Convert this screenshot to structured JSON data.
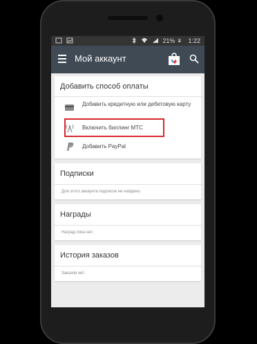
{
  "statusbar": {
    "battery": "21%",
    "time": "1:22"
  },
  "appbar": {
    "title": "Мой аккаунт"
  },
  "payment": {
    "title": "Добавить способ оплаты",
    "items": [
      {
        "label": "Добавить кредитную или дебетовую карту",
        "icon": "credit-card-icon"
      },
      {
        "label": "Включить биллинг МТС",
        "icon": "carrier-billing-icon"
      },
      {
        "label": "Добавить PayPal",
        "icon": "paypal-icon"
      }
    ]
  },
  "subscriptions": {
    "title": "Подписки",
    "note": "Для этого аккаунта подписок не найдено."
  },
  "rewards": {
    "title": "Награды",
    "note": "Наград пока нет."
  },
  "orders": {
    "title": "История заказов",
    "note": "Заказов нет."
  },
  "colors": {
    "appbar": "#3f4a55",
    "highlight": "#d7262e",
    "statusbar": "#343434",
    "background": "#ececec"
  }
}
